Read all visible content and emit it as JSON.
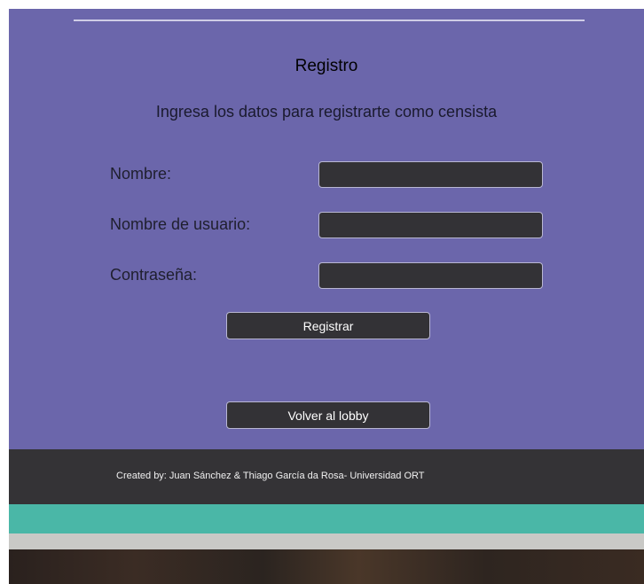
{
  "form": {
    "title": "Registro",
    "subtitle": "Ingresa los datos para registrarte como censista",
    "fields": [
      {
        "label": "Nombre:",
        "value": "",
        "placeholder": ""
      },
      {
        "label": "Nombre de usuario:",
        "value": "",
        "placeholder": ""
      },
      {
        "label": "Contraseña:",
        "value": "",
        "placeholder": ""
      }
    ],
    "submit_label": "Registrar"
  },
  "nav": {
    "back_label": "Volver al lobby"
  },
  "footer": {
    "credits": "Created by: Juan Sánchez & Thiago García da Rosa- Universidad ORT"
  },
  "colors": {
    "panel": "#6b66ab",
    "control": "#333236",
    "footer": "#343336",
    "teal_band": "#4ab7a7",
    "gray_band": "#c9c9c6"
  }
}
